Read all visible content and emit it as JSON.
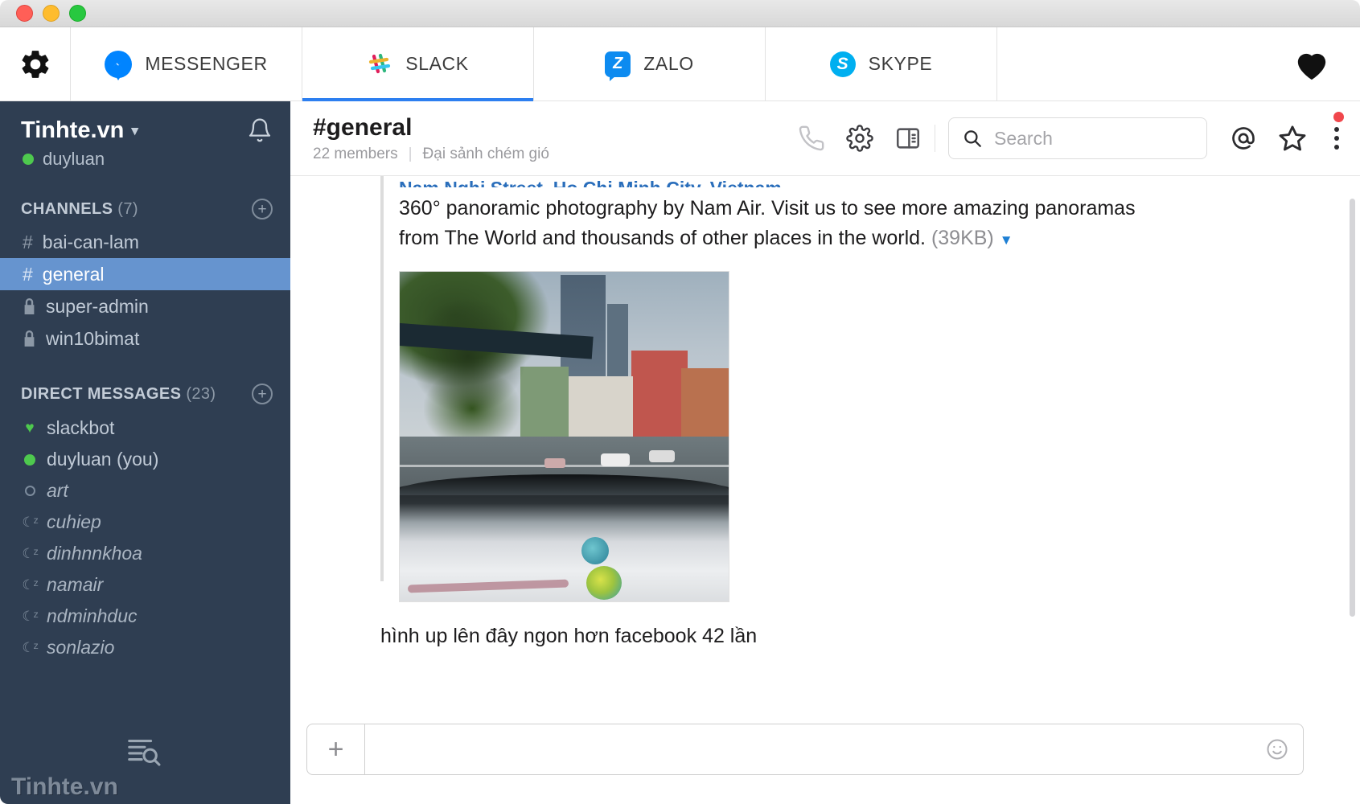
{
  "window": {
    "traffic_lights": [
      "close",
      "minimize",
      "zoom"
    ]
  },
  "tabbar": {
    "settings_icon": "gear-icon",
    "favorite_icon": "heart-icon",
    "tabs": [
      {
        "id": "messenger",
        "label": "MESSENGER",
        "icon": "messenger-icon",
        "active": false
      },
      {
        "id": "slack",
        "label": "SLACK",
        "icon": "slack-icon",
        "active": true
      },
      {
        "id": "zalo",
        "label": "ZALO",
        "icon": "zalo-icon",
        "glyph": "Z",
        "active": false
      },
      {
        "id": "skype",
        "label": "SKYPE",
        "icon": "skype-icon",
        "glyph": "S",
        "active": false
      }
    ],
    "active_indicator_color": "#2d7ff0"
  },
  "sidebar": {
    "team_name": "Tinhte.vn",
    "team_chevron": "▾",
    "notifications_icon": "bell-icon",
    "user": {
      "name": "duyluan",
      "presence": "online",
      "presence_color": "#4ec94e"
    },
    "channels_section": {
      "title": "CHANNELS",
      "count": "(7)",
      "add_icon": "plus-circle-icon",
      "items": [
        {
          "name": "bai-can-lam",
          "prefix": "#",
          "private": false,
          "selected": false
        },
        {
          "name": "general",
          "prefix": "#",
          "private": false,
          "selected": true
        },
        {
          "name": "super-admin",
          "prefix": "lock",
          "private": true,
          "selected": false
        },
        {
          "name": "win10bimat",
          "prefix": "lock",
          "private": true,
          "selected": false
        }
      ]
    },
    "dm_section": {
      "title": "DIRECT MESSAGES",
      "count": "(23)",
      "add_icon": "plus-circle-icon",
      "items": [
        {
          "name": "slackbot",
          "status": "heart",
          "italic": false
        },
        {
          "name": "duyluan (you)",
          "status": "online",
          "italic": false
        },
        {
          "name": "art",
          "status": "away",
          "italic": true
        },
        {
          "name": "cuhiep",
          "status": "snooze",
          "italic": true
        },
        {
          "name": "dinhnnkhoa",
          "status": "snooze",
          "italic": true
        },
        {
          "name": "namair",
          "status": "snooze",
          "italic": true
        },
        {
          "name": "ndminhduc",
          "status": "snooze",
          "italic": true
        },
        {
          "name": "sonlazio",
          "status": "snooze",
          "italic": true
        }
      ]
    },
    "watermark": {
      "text": "Tinhte.vn",
      "icon": "list-search-icon"
    },
    "background_color": "#2f3e52",
    "selected_color": "#6694cf"
  },
  "channel_header": {
    "title": "#general",
    "members": "22 members",
    "separator": "|",
    "topic": "Đại sảnh chém gió",
    "icons": [
      {
        "name": "phone-icon"
      },
      {
        "name": "gear-icon"
      },
      {
        "name": "panel-toggle-icon"
      }
    ],
    "search": {
      "placeholder": "Search",
      "value": "",
      "icon": "search-icon"
    },
    "right_icons": [
      {
        "name": "mention-icon",
        "glyph": "@"
      },
      {
        "name": "star-icon"
      },
      {
        "name": "more-options-icon",
        "has_badge": true,
        "badge_color": "#f0474c"
      }
    ]
  },
  "messages": [
    {
      "type": "attachment",
      "link_text": "Nam Nghi Street, Ho Chi Minh City, Vietnam",
      "description": "360° panoramic photography by Nam Air. Visit us to see more amazing panoramas from The World and thousands of other places in the world.",
      "size": "(39KB)",
      "collapse_caret": "▼",
      "image_alt": "360 panorama of a street in Ho Chi Minh City seen over a car hood"
    },
    {
      "type": "text",
      "text": "hình up lên đây ngon hơn facebook 42 lần"
    }
  ],
  "composer": {
    "add_icon": "plus-icon",
    "placeholder": "",
    "value": "",
    "emoji_icon": "smiley-icon"
  }
}
